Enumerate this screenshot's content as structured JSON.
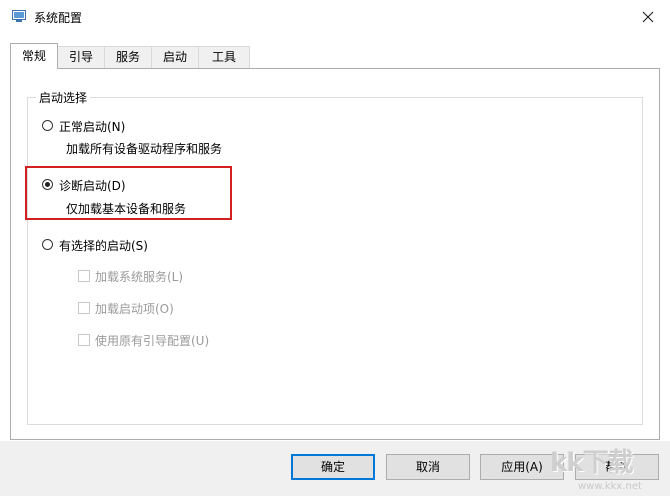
{
  "window": {
    "title": "系统配置"
  },
  "tabs": [
    {
      "label": "常规",
      "active": true
    },
    {
      "label": "引导",
      "active": false
    },
    {
      "label": "服务",
      "active": false
    },
    {
      "label": "启动",
      "active": false
    },
    {
      "label": "工具",
      "active": false
    }
  ],
  "startup_selection": {
    "legend": "启动选择",
    "options": [
      {
        "label": "正常启动(N)",
        "description": "加载所有设备驱动程序和服务",
        "checked": false
      },
      {
        "label": "诊断启动(D)",
        "description": "仅加载基本设备和服务",
        "checked": true
      },
      {
        "label": "有选择的启动(S)",
        "checked": false
      }
    ],
    "selective_items": [
      {
        "label": "加载系统服务(L)",
        "checked": false,
        "enabled": false
      },
      {
        "label": "加载启动项(O)",
        "checked": false,
        "enabled": false
      },
      {
        "label": "使用原有引导配置(U)",
        "checked": false,
        "enabled": false
      }
    ]
  },
  "buttons": {
    "ok": "确定",
    "cancel": "取消",
    "apply": "应用(A)",
    "help": "帮助"
  },
  "watermark": {
    "brand": "kk下载",
    "url": "www.kkx.net"
  },
  "colors": {
    "highlight_box": "#d21f1f",
    "default_button_border": "#0078d7"
  }
}
